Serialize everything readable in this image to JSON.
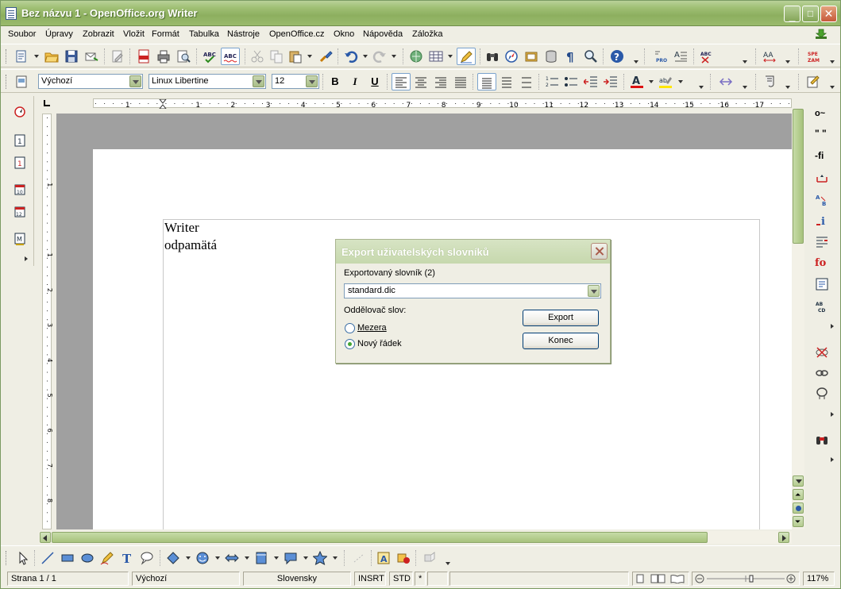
{
  "window": {
    "title": "Bez názvu 1 - OpenOffice.org Writer"
  },
  "menubar": {
    "items": [
      {
        "label": "Soubor",
        "accel": "S"
      },
      {
        "label": "Úpravy",
        "accel": "Ú"
      },
      {
        "label": "Zobrazit",
        "accel": "Z"
      },
      {
        "label": "Vložit",
        "accel": "l"
      },
      {
        "label": "Formát",
        "accel": "F"
      },
      {
        "label": "Tabulka",
        "accel": "T"
      },
      {
        "label": "Nástroje",
        "accel": "N"
      },
      {
        "label": "OpenOffice.cz",
        "accel": ""
      },
      {
        "label": "Okno",
        "accel": "O"
      },
      {
        "label": "Nápověda",
        "accel": "v"
      },
      {
        "label": "Záložka",
        "accel": "Z"
      }
    ]
  },
  "formatting": {
    "style": "Výchozí",
    "font": "Linux Libertine",
    "size": "12",
    "bold": "B",
    "italic": "I",
    "underline": "U"
  },
  "document": {
    "lines": [
      "Writer",
      "odpamätá"
    ]
  },
  "ruler": {
    "labels": [
      "1",
      "1",
      "2",
      "3",
      "4",
      "5",
      "6",
      "7",
      "8",
      "9",
      "10",
      "11",
      "12",
      "13",
      "14",
      "15",
      "16",
      "17"
    ],
    "vlabels": [
      "1",
      "1",
      "2",
      "3",
      "4",
      "5",
      "6",
      "7",
      "8"
    ]
  },
  "dialog": {
    "title": "Export uživatelských slovníků",
    "dictionary_label": "Exportovaný slovník (2)",
    "dictionary_value": "standard.dic",
    "separator_label": "Oddělovač slov:",
    "option_space": "Mezera",
    "option_newline": "Nový řádek",
    "selected_option": "Nový řádek",
    "export_button": "Export",
    "close_button": "Konec"
  },
  "statusbar": {
    "page": "Strana 1 / 1",
    "style": "Výchozí",
    "language": "Slovensky",
    "insert_mode": "INSRT",
    "selection_mode": "STD",
    "modified": "*",
    "zoom": "117%"
  },
  "right_toolbar_labels": {
    "spell": "SPE\nZAM",
    "fi": "-fi",
    "quotes": "\" \"",
    "degree": "o~"
  }
}
